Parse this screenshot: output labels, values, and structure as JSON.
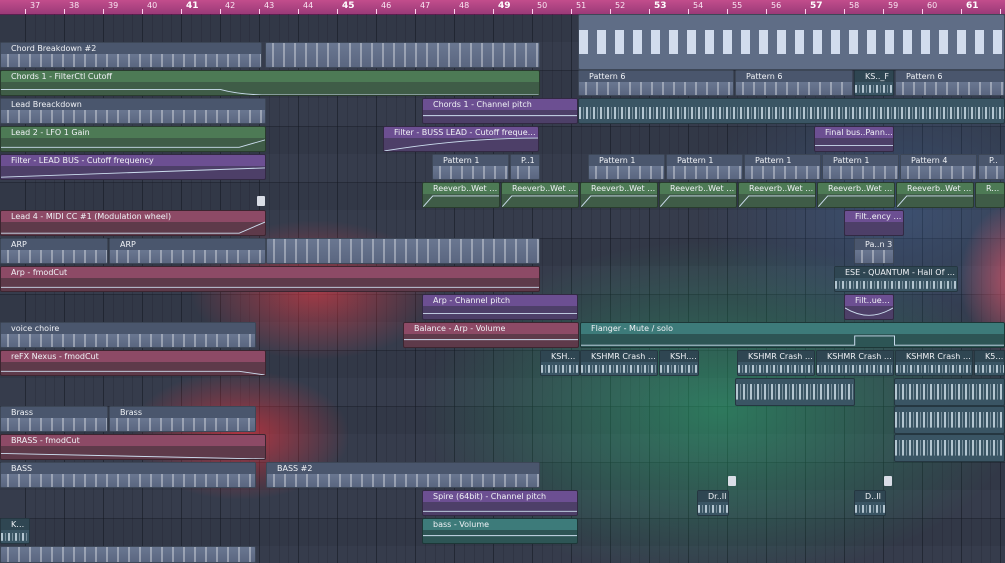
{
  "ruler": {
    "bars": [
      "37",
      "38",
      "39",
      "40",
      "41",
      "42",
      "43",
      "44",
      "45",
      "46",
      "47",
      "48",
      "49",
      "50",
      "51",
      "52",
      "53",
      "54",
      "55",
      "56",
      "57",
      "58",
      "59",
      "60",
      "61"
    ]
  },
  "lanes": {
    "chord_breakdown_2": "Chord Breakdown #2",
    "chords1_filterctl": "Chords 1 - FilterCtl Cutoff",
    "lead_breakdown": "Lead Breackdown",
    "chords1_channel_pitch": "Chords 1 - Channel pitch",
    "lead2_lfo": "Lead 2 - LFO 1 Gain",
    "filter_buss_lead": "Filter - BUSS LEAD - Cutoff frequency",
    "final_bus_panning": "Final bus..Panning",
    "filter_lead_bus": "Filter - LEAD BUS - Cutoff frequency",
    "lead4_midi": "Lead 4 - MIDI CC #1 (Modulation wheel)",
    "filt_ency2": "Filt..ency #2",
    "arp": "ARP",
    "pa_n3": "Pa..n 3",
    "arp_fmodcut": "Arp - fmodCut",
    "ese_quantum": "ESE - QUANTUM - Hall Of Fame",
    "arp_channel_pitch": "Arp - Channel pitch",
    "filt_uency": "Filt..uency",
    "voice_choire": "voice choire",
    "balance_arp": "Balance - Arp - Volume",
    "flanger": "Flanger - Mute / solo",
    "refx_nexus": "reFX Nexus - fmodCut",
    "ksmhr": "KSHMR",
    "brass": "Brass",
    "brass_fmodcut": "BRASS - fmodCut",
    "bass": "BASS",
    "bass_2": "BASS #2",
    "spire": "Spire (64bit) - Channel pitch",
    "dr_ii": "Dr..II",
    "d_ii": "D..II",
    "ksh": "KSH..",
    "bass_volume": "bass - Volume"
  },
  "patterns": {
    "pattern6": "Pattern 6",
    "ks_f": "KS.._F",
    "pattern1": "Pattern 1",
    "p_1": "P..1",
    "pattern4": "Pattern 4",
    "p_ellip": "P..",
    "reverb_wet": "Reeverb..Wet level",
    "re_wet": "Re..we",
    "ksmhr_crash": "KSHMR Crash 05",
    "ksh_05": "KSH..05",
    "k5_05": "K5..05"
  }
}
